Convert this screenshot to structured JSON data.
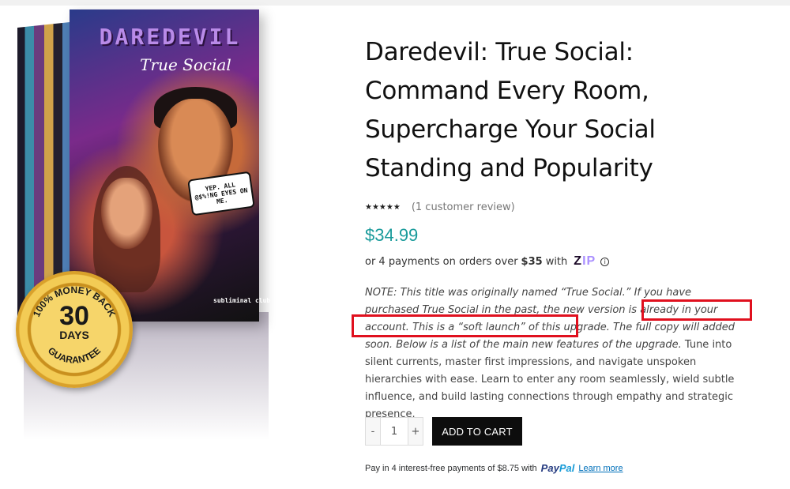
{
  "product": {
    "box_title": "DAREDEVIL",
    "box_subtitle": "True Social",
    "speech_bubble": "YEP. ALL @$%!NG EYES ON ME.",
    "brand": "subliminal club",
    "badge": {
      "ring_text_top": "100% MONEY BACK",
      "ring_text_bottom": "GUARANTEE",
      "number": "30",
      "unit": "DAYS"
    },
    "title_lines": [
      "Daredevil: True Social:",
      "Command Every Room,",
      "Supercharge Your Social",
      "Standing and Popularity"
    ],
    "rating": {
      "stars": "★★★★★",
      "review_text": "(1 customer review)"
    },
    "price": "$34.99",
    "zip": {
      "prefix": "or 4 payments on orders over",
      "amount": "$35",
      "with": "with",
      "logo_a": "Z",
      "logo_b": "IP",
      "info_icon": "info-icon"
    },
    "description": {
      "note_1": "NOTE: This title was originally named “True Social.” If you have purchased True Social in the past, the new version is already in your account.",
      "note_highlight": " This is a “soft launch” of this upgrade. The full copy will added soon.",
      "note_2": " Below is a list of the main new features of the upgrade.",
      "body": " Tune into silent currents, master first impressions, and navigate unspoken hierarchies with ease. Learn to enter any room seamlessly, wield subtle influence, and build lasting connections through empathy and strategic presence."
    },
    "quantity": {
      "minus": "-",
      "value": "1",
      "plus": "+"
    },
    "add_to_cart": "ADD TO CART",
    "paypal": {
      "text": "Pay in 4 interest-free payments of $8.75 with",
      "logo_a": "Pay",
      "logo_b": "Pal",
      "learn_more": "Learn more"
    }
  },
  "colors": {
    "price": "#1a9b9b",
    "highlight_box": "#e0101e",
    "button_bg": "#0d0d0d"
  }
}
